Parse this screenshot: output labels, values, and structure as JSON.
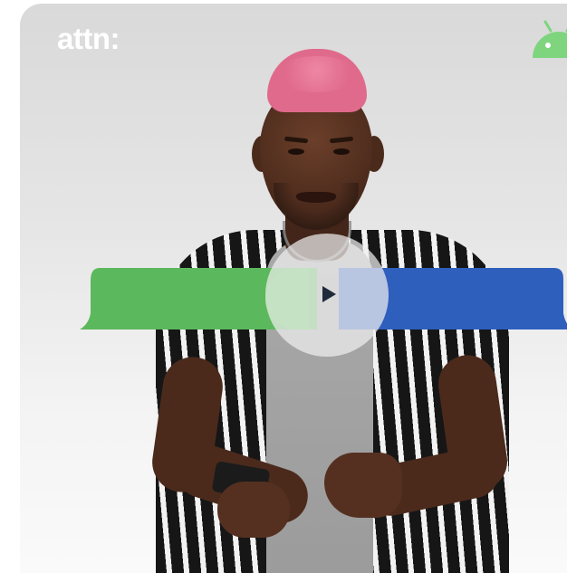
{
  "brand": {
    "logo_text": "attn:"
  },
  "icons": {
    "android": "android-robot-icon",
    "play": "play-icon"
  },
  "colors": {
    "bubble_green": "#5cb85c",
    "bubble_blue": "#2f5fbd",
    "android_green": "#7ed57e",
    "hair_pink": "#e06a8b"
  }
}
